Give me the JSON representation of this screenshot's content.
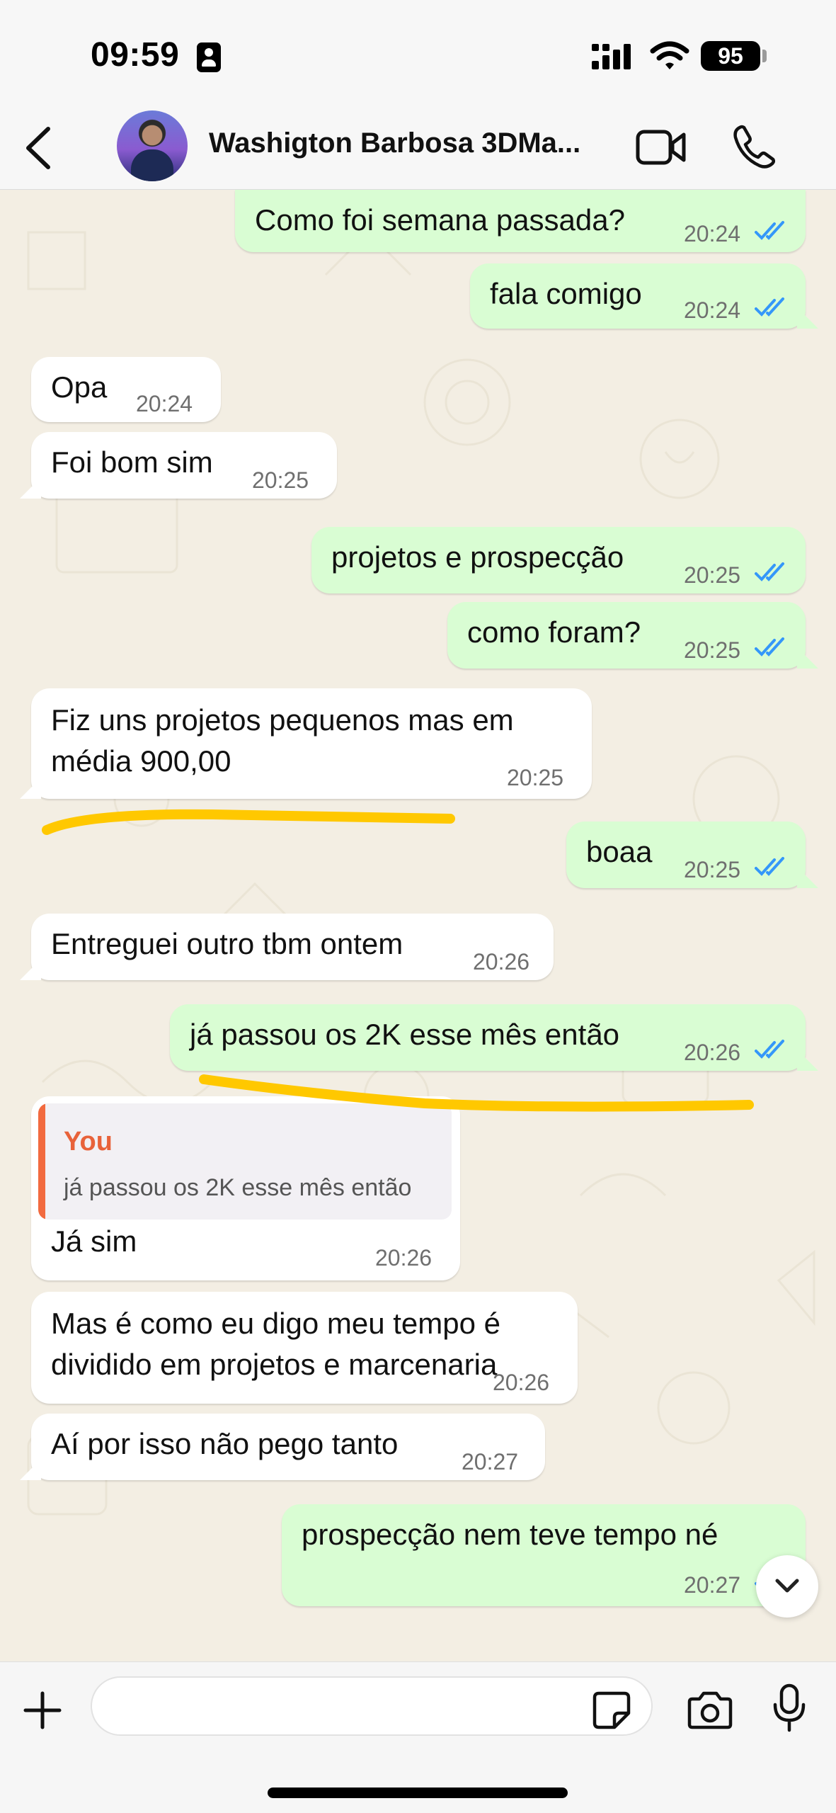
{
  "status_bar": {
    "time": "09:59",
    "battery": "95"
  },
  "header": {
    "contact_name": "Washigton Barbosa 3DMa...",
    "back_icon": "chevron-left-icon",
    "video_icon": "video-camera-icon",
    "call_icon": "phone-icon"
  },
  "messages": [
    {
      "direction": "out",
      "text": "Como foi semana passada?",
      "time": "20:24",
      "status": "read"
    },
    {
      "direction": "out",
      "text": "fala comigo",
      "time": "20:24",
      "status": "read"
    },
    {
      "direction": "in",
      "text": "Opa",
      "time": "20:24"
    },
    {
      "direction": "in",
      "text": "Foi bom sim",
      "time": "20:25"
    },
    {
      "direction": "out",
      "text": "projetos e prospecção",
      "time": "20:25",
      "status": "read"
    },
    {
      "direction": "out",
      "text": "como foram?",
      "time": "20:25",
      "status": "read"
    },
    {
      "direction": "in",
      "lines": [
        "Fiz uns projetos pequenos mas em",
        "média  900,00"
      ],
      "time": "20:25"
    },
    {
      "direction": "out",
      "text": "boaa",
      "time": "20:25",
      "status": "read"
    },
    {
      "direction": "in",
      "text": "Entreguei outro tbm ontem",
      "time": "20:26"
    },
    {
      "direction": "out",
      "text": "já passou os 2K esse mês então",
      "time": "20:26",
      "status": "read"
    },
    {
      "direction": "in",
      "quote": {
        "author": "You",
        "text": "já passou os 2K esse mês então"
      },
      "text": "Já sim",
      "time": "20:26"
    },
    {
      "direction": "in",
      "lines": [
        "Mas é como eu digo meu tempo é",
        "dividido em projetos e marcenaria"
      ],
      "time": "20:26"
    },
    {
      "direction": "in",
      "text": "Aí por isso não pego tanto",
      "time": "20:27"
    },
    {
      "direction": "out",
      "text": "prospecção nem teve tempo né",
      "time": "20:27",
      "status": "read"
    }
  ],
  "composer": {
    "input_value": "",
    "placeholder": "",
    "icons": [
      "plus-icon",
      "sticker-icon",
      "camera-icon",
      "microphone-icon"
    ]
  },
  "colors": {
    "outgoing_bubble": "#d9fdd3",
    "incoming_bubble": "#ffffff",
    "read_ticks": "#3497f9",
    "highlight_marker": "#ffc800",
    "quote_accent": "#e8623a"
  }
}
